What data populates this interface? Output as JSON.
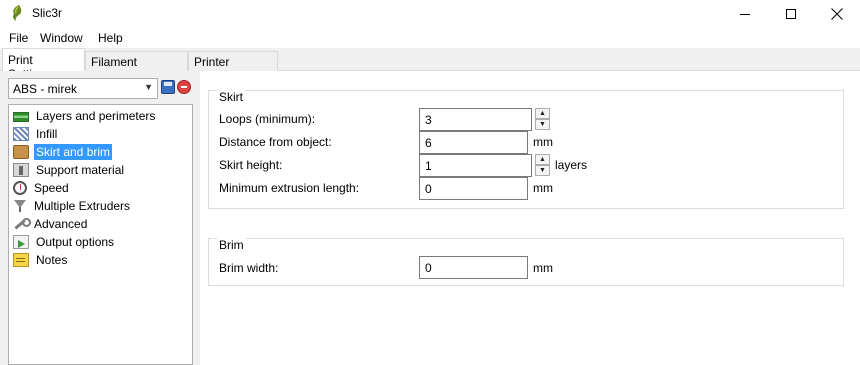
{
  "window": {
    "title": "Slic3r",
    "icon": "slic3r-logo-icon"
  },
  "menu": {
    "items": [
      "File",
      "Window",
      "Help"
    ]
  },
  "tabs": [
    {
      "label": "Print Settings",
      "active": true
    },
    {
      "label": "Filament Settings",
      "active": false
    },
    {
      "label": "Printer Settings",
      "active": false
    }
  ],
  "preset": {
    "selected": "ABS - mirek",
    "save_icon": "save-icon",
    "delete_icon": "delete-icon"
  },
  "sidebar": {
    "items": [
      {
        "label": "Layers and perimeters",
        "icon": "layers-icon",
        "selected": false
      },
      {
        "label": "Infill",
        "icon": "infill-icon",
        "selected": false
      },
      {
        "label": "Skirt and brim",
        "icon": "skirt-icon",
        "selected": true
      },
      {
        "label": "Support material",
        "icon": "support-icon",
        "selected": false
      },
      {
        "label": "Speed",
        "icon": "speed-icon",
        "selected": false
      },
      {
        "label": "Multiple Extruders",
        "icon": "extruders-icon",
        "selected": false
      },
      {
        "label": "Advanced",
        "icon": "wrench-icon",
        "selected": false
      },
      {
        "label": "Output options",
        "icon": "output-icon",
        "selected": false
      },
      {
        "label": "Notes",
        "icon": "notes-icon",
        "selected": false
      }
    ],
    "selected_color": "#3399ff"
  },
  "skirt": {
    "title": "Skirt",
    "loops_label": "Loops (minimum):",
    "loops_value": "3",
    "distance_label": "Distance from object:",
    "distance_value": "6",
    "distance_unit": "mm",
    "height_label": "Skirt height:",
    "height_value": "1",
    "height_unit": "layers",
    "min_extrusion_label": "Minimum extrusion length:",
    "min_extrusion_value": "0",
    "min_extrusion_unit": "mm"
  },
  "brim": {
    "title": "Brim",
    "width_label": "Brim width:",
    "width_value": "0",
    "width_unit": "mm"
  }
}
